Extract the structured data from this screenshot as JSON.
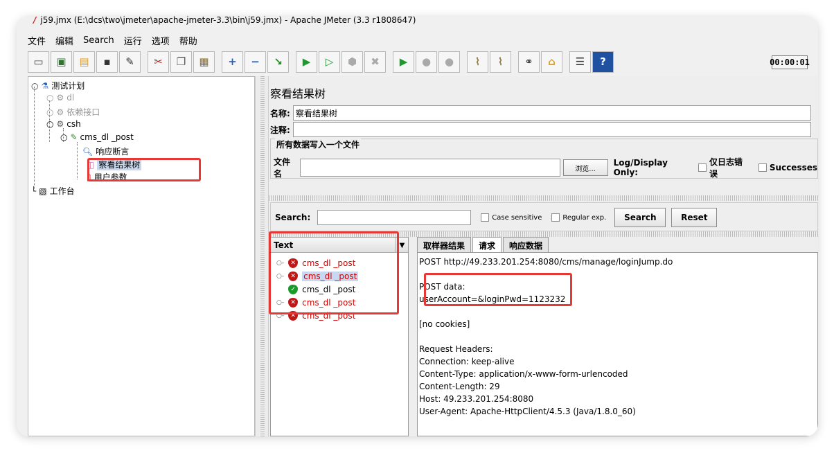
{
  "window": {
    "title": "j59.jmx (E:\\dcs\\two\\jmeter\\apache-jmeter-3.3\\bin\\j59.jmx) - Apache JMeter (3.3 r1808647)"
  },
  "menu": [
    "文件",
    "编辑",
    "Search",
    "运行",
    "选项",
    "帮助"
  ],
  "toolbar": {
    "timer": "00:00:01",
    "icons": [
      "new-icon",
      "templates-icon",
      "open-icon",
      "save-icon",
      "save-as-icon",
      "cut-icon",
      "copy-icon",
      "paste-icon",
      "expand-icon",
      "collapse-icon",
      "toggle-icon",
      "start-icon",
      "start-no-pause-icon",
      "stop-icon",
      "shutdown-icon",
      "remote-start-icon",
      "remote-stop-icon",
      "remote-exit-icon",
      "clear-icon",
      "clear-all-icon",
      "search-icon",
      "reset-search-icon",
      "function-helper-icon",
      "help-icon"
    ]
  },
  "tree": {
    "root": "测试计划",
    "items": [
      {
        "label": "dl"
      },
      {
        "label": "依赖接口"
      },
      {
        "label": "csh"
      },
      {
        "label": "cms_dl _post"
      },
      {
        "label": "响应断言"
      },
      {
        "label": "察看结果树"
      },
      {
        "label": "用户参数"
      }
    ],
    "workbench": "工作台"
  },
  "panel": {
    "title": "察看结果树",
    "name_label": "名称:",
    "name_value": "察看结果树",
    "comment_label": "注释:",
    "comment_value": "",
    "group_title": "所有数据写入一个文件",
    "file_label": "文件名",
    "file_value": "",
    "browse_label": "浏览...",
    "log_display_label": "Log/Display Only:",
    "errors_only_label": "仅日志错误",
    "successes_label": "Successes"
  },
  "search": {
    "label": "Search:",
    "value": "",
    "case_sensitive": "Case sensitive",
    "regex": "Regular exp.",
    "search_button": "Search",
    "reset_button": "Reset"
  },
  "results": {
    "header": "Text",
    "items": [
      {
        "label": "cms_dl _post",
        "status": "fail"
      },
      {
        "label": "cms_dl _post",
        "status": "fail",
        "selected": true
      },
      {
        "label": "cms_dl _post",
        "status": "ok"
      },
      {
        "label": "cms_dl _post",
        "status": "fail"
      },
      {
        "label": "cms_dl _post",
        "status": "fail"
      }
    ]
  },
  "tabs": [
    {
      "label": "取样器结果"
    },
    {
      "label": "请求",
      "active": true
    },
    {
      "label": "响应数据"
    }
  ],
  "request": {
    "lines": [
      "POST http://49.233.201.254:8080/cms/manage/loginJump.do",
      "",
      "POST data:",
      "userAccount=&loginPwd=1123232",
      "",
      "[no cookies]",
      "",
      "Request Headers:",
      "Connection: keep-alive",
      "Content-Type: application/x-www-form-urlencoded",
      "Content-Length: 29",
      "Host: 49.233.201.254:8080",
      "User-Agent: Apache-HttpClient/4.5.3 (Java/1.8.0_60)"
    ]
  },
  "colors": {
    "highlight": "#e53935",
    "fail": "#c01818",
    "ok": "#1a9a2a",
    "selection": "#c8d8f0"
  }
}
